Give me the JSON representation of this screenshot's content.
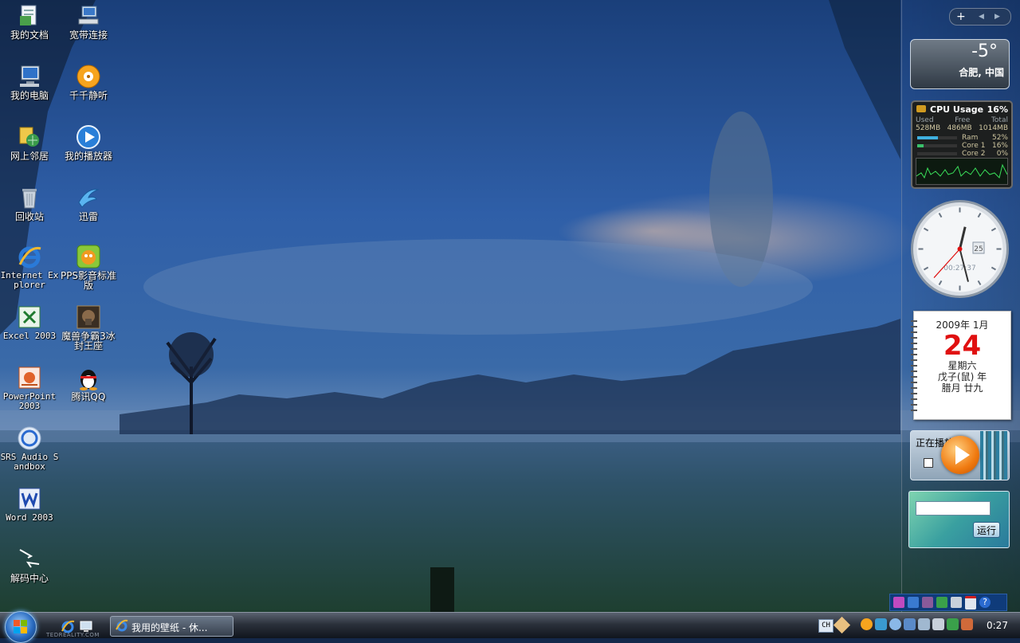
{
  "desktop": {
    "icons": [
      {
        "id": "docs",
        "label": "我的文档",
        "icon": "my-documents-icon"
      },
      {
        "id": "broadband",
        "label": "宽带连接",
        "icon": "broadband-connection-icon"
      },
      {
        "id": "computer",
        "label": "我的电脑",
        "icon": "my-computer-icon"
      },
      {
        "id": "ttplayer",
        "label": "千千静听",
        "icon": "ttplayer-icon"
      },
      {
        "id": "network",
        "label": "网上邻居",
        "icon": "network-places-icon"
      },
      {
        "id": "myplayer",
        "label": "我的播放器",
        "icon": "media-player-icon"
      },
      {
        "id": "recycle",
        "label": "回收站",
        "icon": "recycle-bin-icon"
      },
      {
        "id": "thunder",
        "label": "迅雷",
        "icon": "thunder-icon"
      },
      {
        "id": "ie",
        "label": "Internet Explorer",
        "icon": "internet-explorer-icon"
      },
      {
        "id": "pps",
        "label": "PPS影音标准版",
        "icon": "pps-player-icon"
      },
      {
        "id": "excel",
        "label": "Excel 2003",
        "icon": "excel-icon"
      },
      {
        "id": "warcraft",
        "label": "魔兽争霸3冰封王座",
        "icon": "warcraft-icon"
      },
      {
        "id": "powerpoint",
        "label": "PowerPoint 2003",
        "icon": "powerpoint-icon"
      },
      {
        "id": "qq",
        "label": "腾讯QQ",
        "icon": "qq-penguin-icon"
      },
      {
        "id": "srs",
        "label": "SRS Audio Sandbox",
        "icon": "srs-audio-icon"
      },
      {
        "id": "word",
        "label": "Word 2003",
        "icon": "word-icon"
      },
      {
        "id": "codec",
        "label": "解码中心",
        "icon": "shortcut-arrows-icon"
      }
    ]
  },
  "sidebar": {
    "controls": {
      "add": "+",
      "prev": "◀",
      "next": "▶"
    },
    "weather": {
      "temperature": "-5°",
      "location": "合肥, 中国"
    },
    "cpu": {
      "title": "CPU Usage",
      "percent": "16%",
      "headers": [
        "Used",
        "Free",
        "Total"
      ],
      "values": [
        "528MB",
        "486MB",
        "1014MB"
      ],
      "meters": [
        {
          "label": "Ram",
          "value": "52%",
          "fill": 0.52
        },
        {
          "label": "Core 1",
          "value": "16%",
          "fill": 0.16
        },
        {
          "label": "Core 2",
          "value": "0%",
          "fill": 0.0
        }
      ]
    },
    "clock": {
      "time": "00:27:37",
      "date_box": "25",
      "hour": 0,
      "minute": 27,
      "second": 37
    },
    "calendar": {
      "year_month": "2009年 1月",
      "day": "24",
      "weekday": "星期六",
      "lunar_year": "戊子(鼠) 年",
      "lunar_date": "腊月 廿九"
    },
    "player": {
      "label": "正在播放"
    },
    "runbox": {
      "input_value": "",
      "button": "运行"
    }
  },
  "taskbar": {
    "task": "我用的壁纸 - 休...",
    "language": "CH",
    "time": "0:27",
    "watermark": "TEDREALITY.COM"
  },
  "colors": {
    "accent": "#2a6bc0",
    "clock_hand": "#e01010",
    "calendar_day": "#e01010"
  }
}
